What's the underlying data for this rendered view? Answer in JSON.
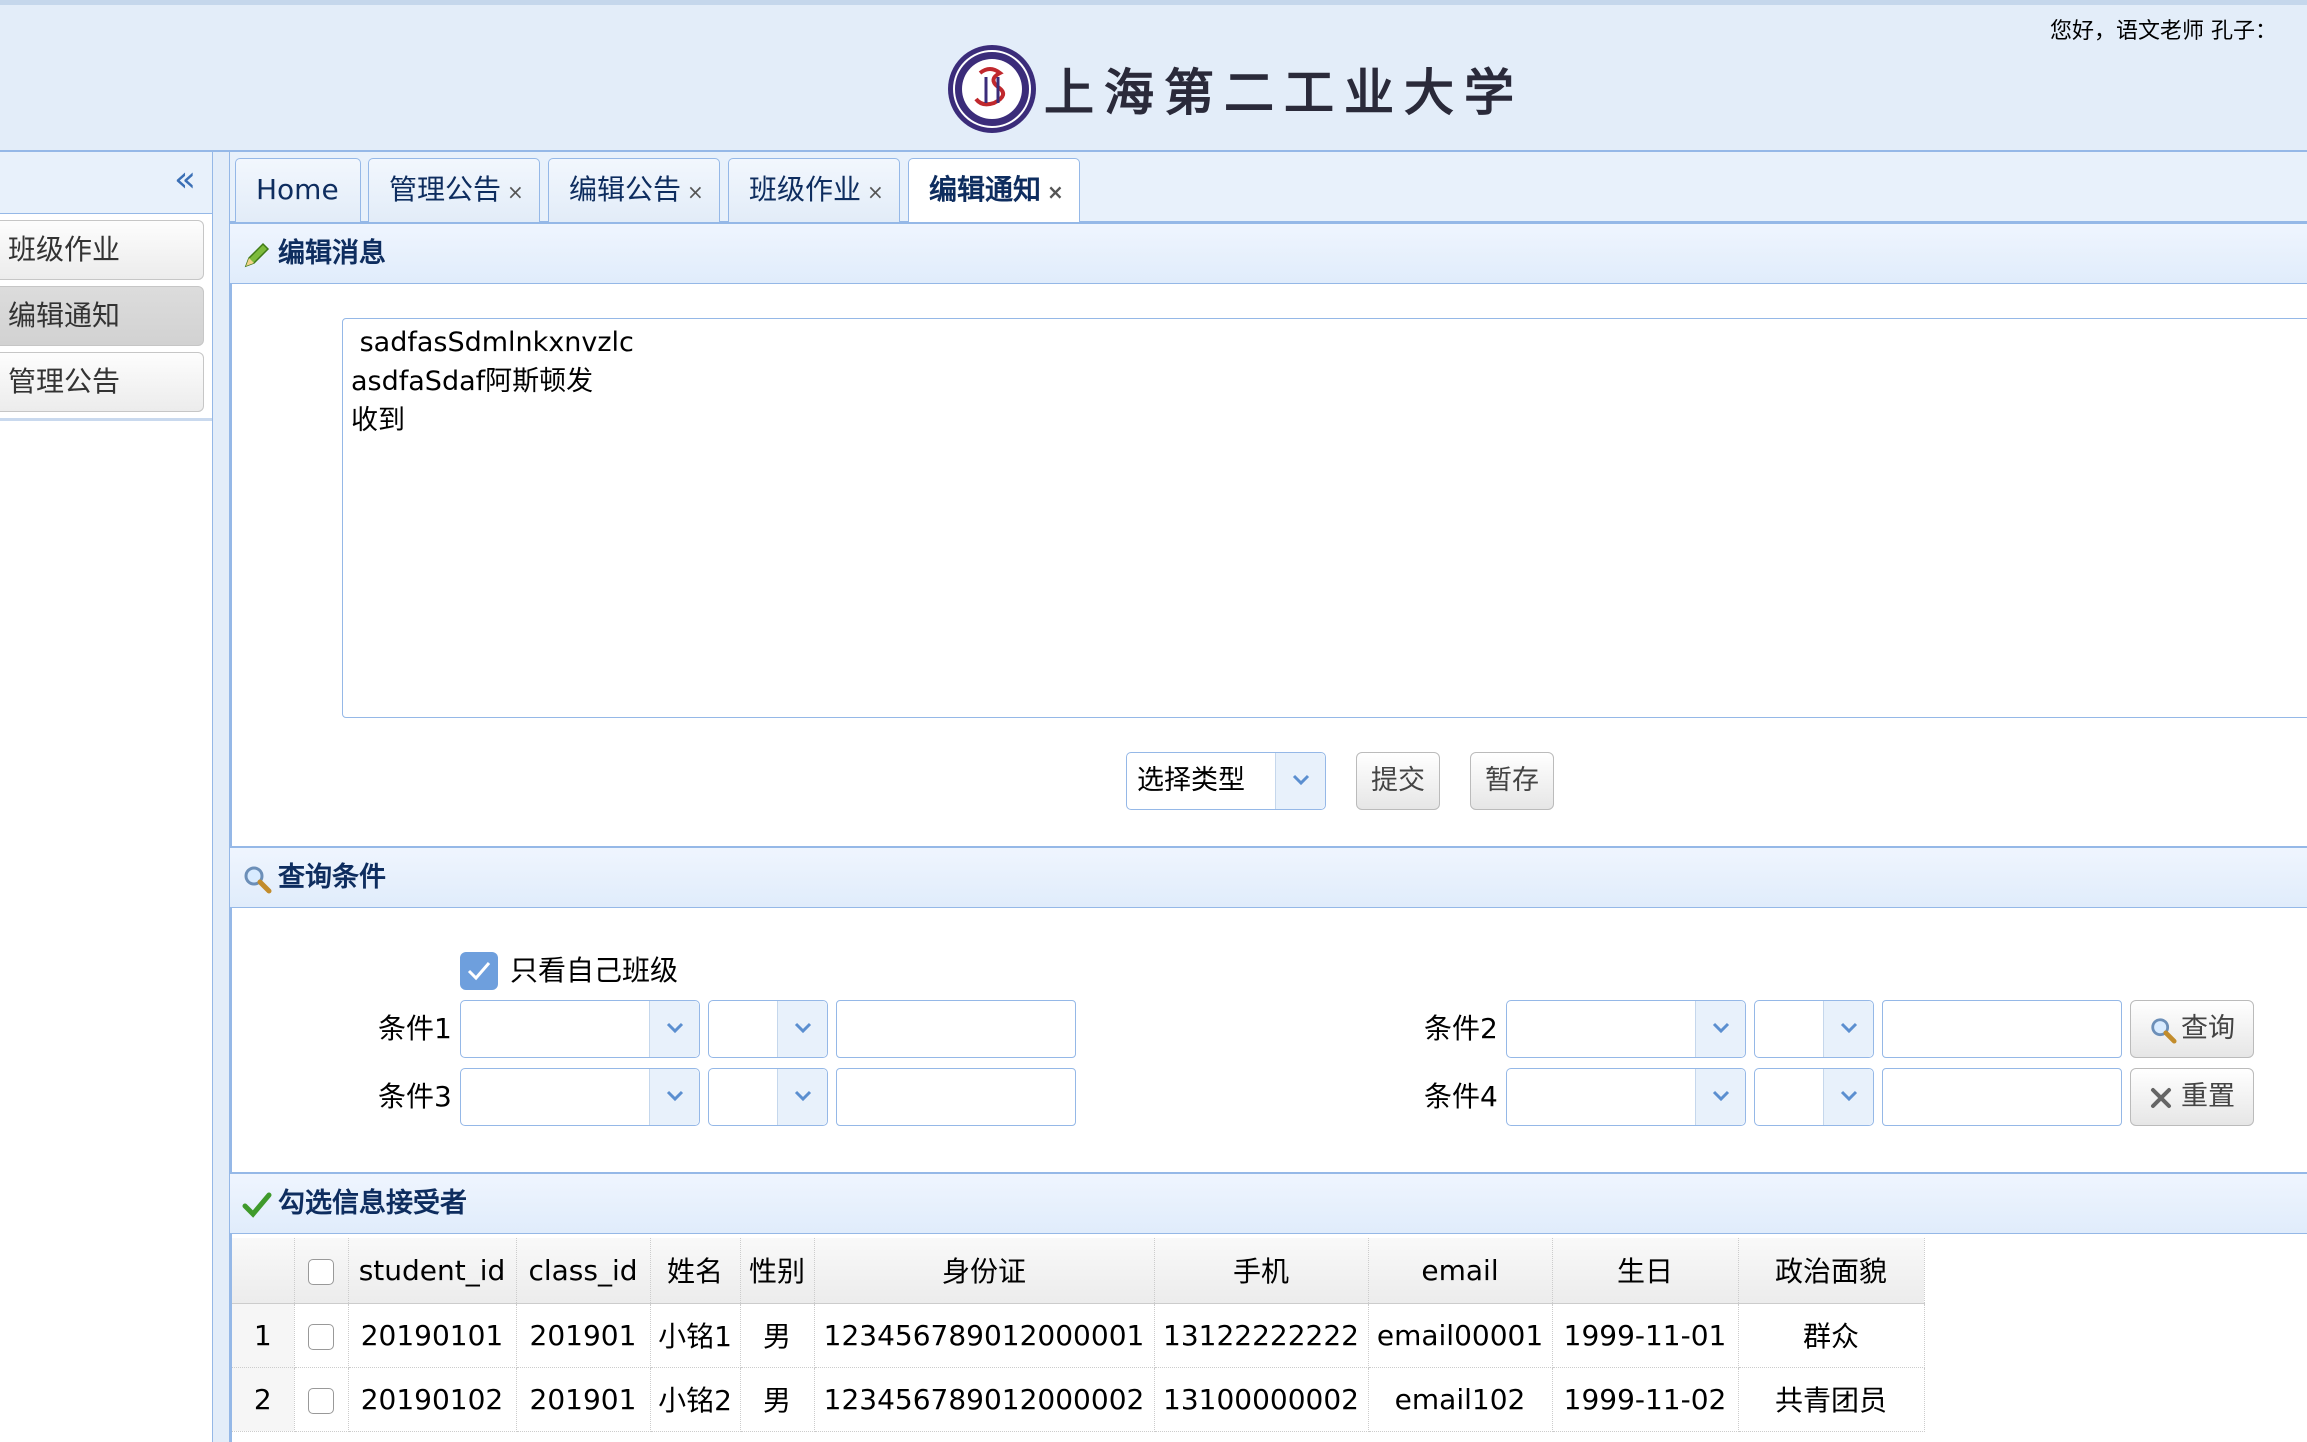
{
  "header": {
    "greeting": "您好，语文老师 孔子：",
    "logo_text": "上海第二工业大学"
  },
  "sidebar": {
    "collapse_glyph": "«",
    "items": [
      {
        "label": "班级作业"
      },
      {
        "label": "编辑通知"
      },
      {
        "label": "管理公告"
      }
    ]
  },
  "tabs": [
    {
      "label": "Home"
    },
    {
      "label": "管理公告"
    },
    {
      "label": "编辑公告"
    },
    {
      "label": "班级作业"
    },
    {
      "label": "编辑通知"
    }
  ],
  "tab_close_glyph": "×",
  "edit_panel": {
    "title": "编辑消息",
    "content": " sadfasSdmlnkxnvzlc\nasdfaSdaf阿斯顿发\n收到",
    "type_select": "选择类型",
    "submit_label": "提交",
    "save_draft_label": "暂存"
  },
  "query_panel": {
    "title": "查询条件",
    "own_class_only": "只看自己班级",
    "conditions": [
      "条件1",
      "条件2",
      "条件3",
      "条件4"
    ],
    "search_label": "查询",
    "reset_label": "重置"
  },
  "recipients_panel": {
    "title": "勾选信息接受者",
    "columns": [
      "student_id",
      "class_id",
      "姓名",
      "性别",
      "身份证",
      "手机",
      "email",
      "生日",
      "政治面貌"
    ],
    "rows": [
      {
        "num": "1",
        "student_id": "20190101",
        "class_id": "201901",
        "name": "小铭1",
        "gender": "男",
        "id_card": "123456789012000001",
        "phone": "13122222222",
        "email": "email00001",
        "birthday": "1999-11-01",
        "political": "群众"
      },
      {
        "num": "2",
        "student_id": "20190102",
        "class_id": "201901",
        "name": "小铭2",
        "gender": "男",
        "id_card": "123456789012000002",
        "phone": "13100000002",
        "email": "email102",
        "birthday": "1999-11-02",
        "political": "共青团员"
      }
    ]
  },
  "colors": {
    "accent": "#95b8e7",
    "header_bg": "#e3edf9",
    "title_text": "#0e2d5f"
  }
}
